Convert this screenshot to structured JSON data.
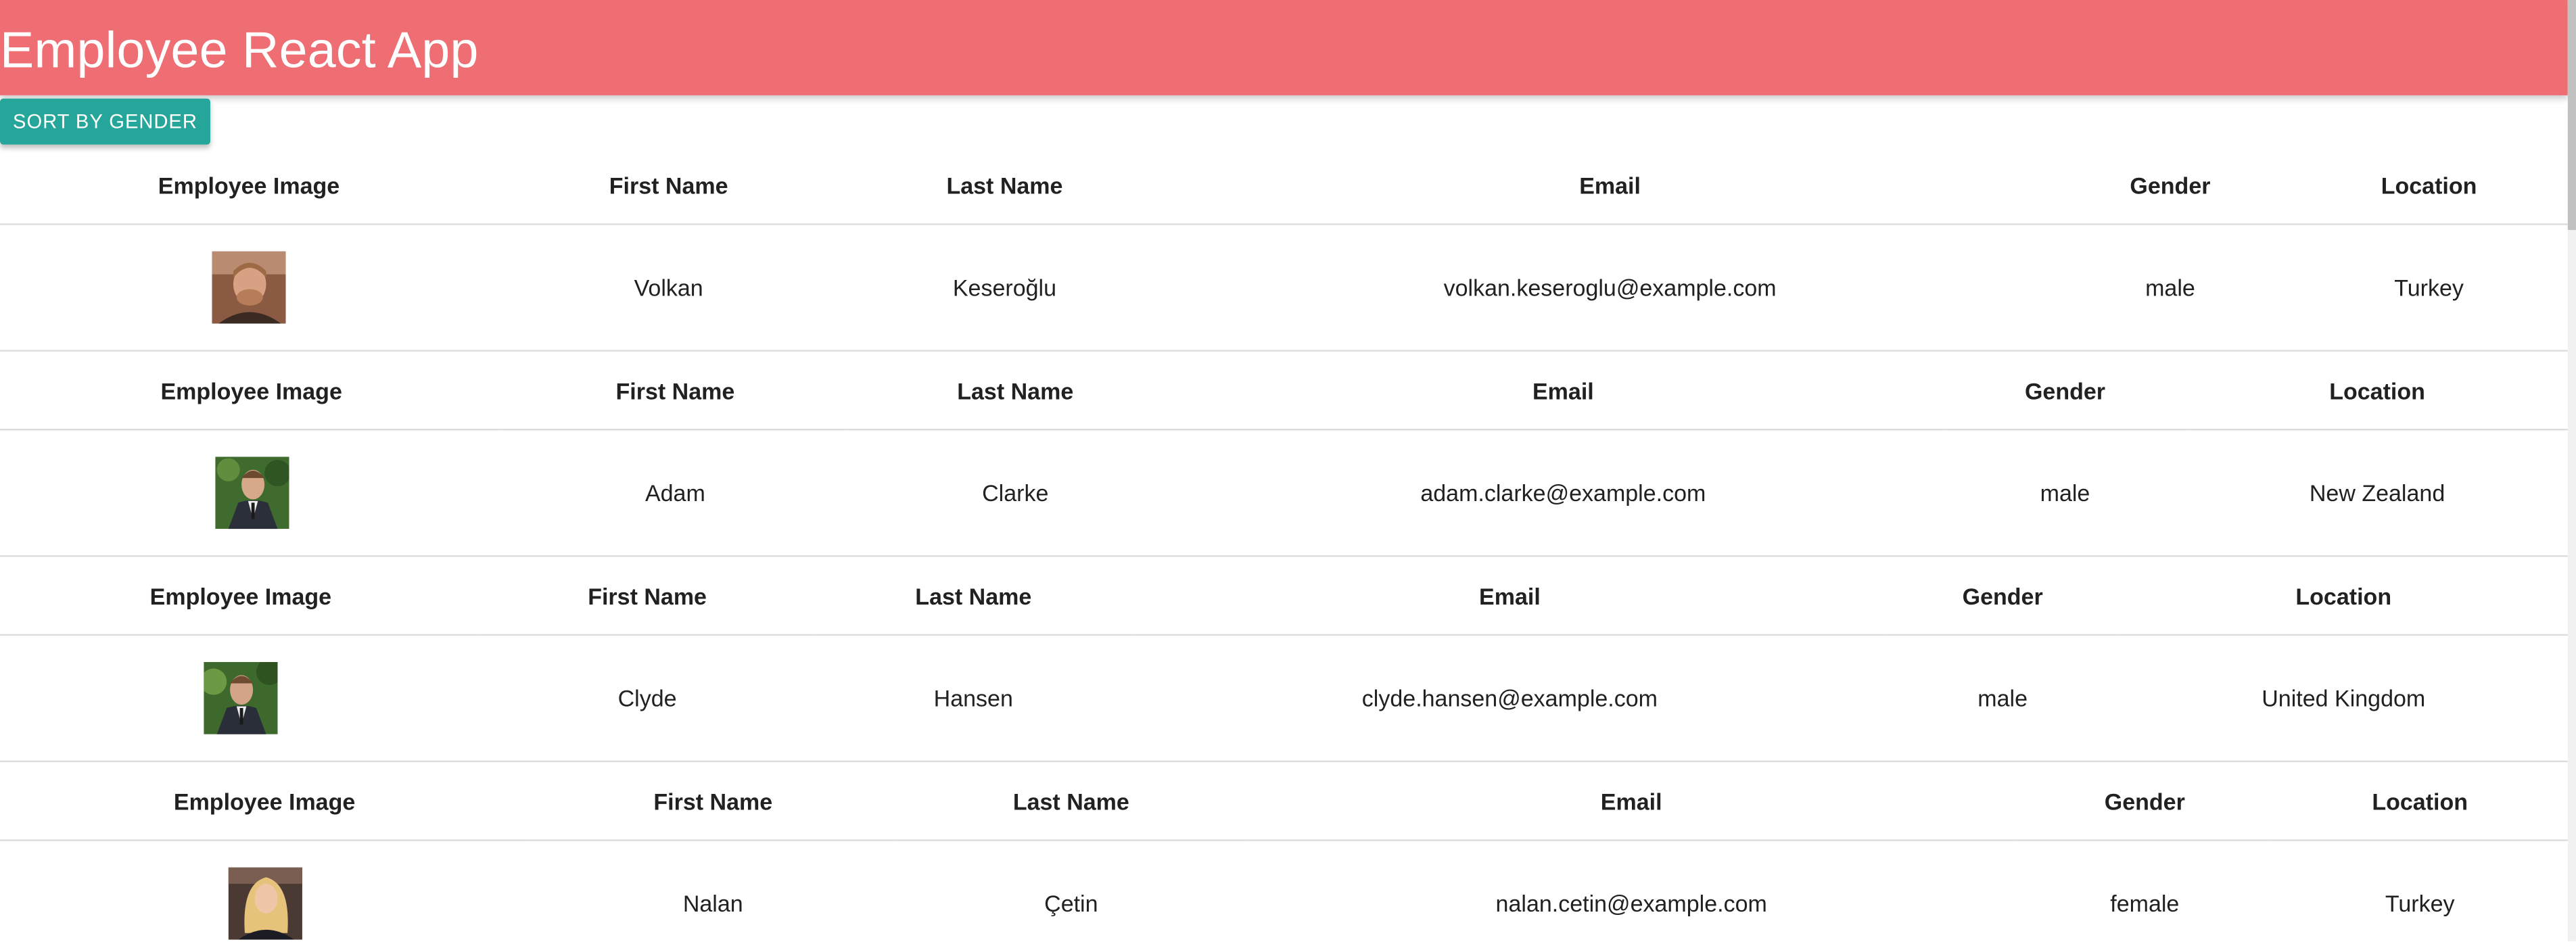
{
  "app": {
    "title": "Employee React App"
  },
  "toolbar": {
    "sort_label": "SORT BY GENDER"
  },
  "colors": {
    "header_bg": "#ef6e74",
    "button_bg": "#26a69a",
    "header_text": "#ffffff"
  },
  "columns": [
    "Employee Image",
    "First Name",
    "Last Name",
    "Email",
    "Gender",
    "Location"
  ],
  "employees": [
    {
      "image": "avatar-icon",
      "first": "Volkan",
      "last": "Keseroğlu",
      "email": "volkan.keseroglu@example.com",
      "gender": "male",
      "location": "Turkey"
    },
    {
      "image": "avatar-icon",
      "first": "Adam",
      "last": "Clarke",
      "email": "adam.clarke@example.com",
      "gender": "male",
      "location": "New Zealand"
    },
    {
      "image": "avatar-icon",
      "first": "Clyde",
      "last": "Hansen",
      "email": "clyde.hansen@example.com",
      "gender": "male",
      "location": "United Kingdom"
    },
    {
      "image": "avatar-icon",
      "first": "Nalan",
      "last": "Çetin",
      "email": "nalan.cetin@example.com",
      "gender": "female",
      "location": "Turkey"
    }
  ]
}
